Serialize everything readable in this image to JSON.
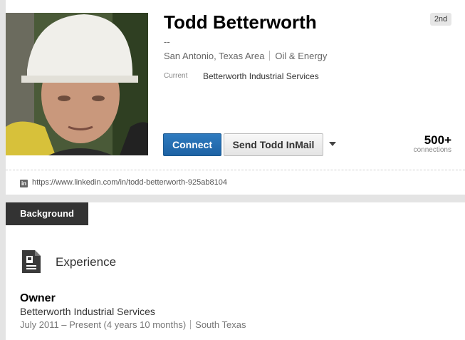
{
  "profile": {
    "name": "Todd Betterworth",
    "degree": "2nd",
    "headline": "--",
    "location": "San Antonio, Texas Area",
    "industry": "Oil & Energy",
    "current_label": "Current",
    "current_value": "Betterworth Industrial Services",
    "connect_label": "Connect",
    "inmail_label": "Send Todd InMail",
    "connections_count": "500+",
    "connections_label": "connections",
    "url": "https://www.linkedin.com/in/todd-betterworth-925ab8104"
  },
  "icons": {
    "linkedin": "linkedin-icon",
    "experience": "document-icon",
    "dropdown": "caret-down-icon"
  },
  "colors": {
    "connect_button": "#1d62a4",
    "background_tab": "#333333"
  },
  "background": {
    "tab_label": "Background",
    "experience_heading": "Experience",
    "positions": [
      {
        "title": "Owner",
        "company": "Betterworth Industrial Services",
        "dates": "July 2011 – Present (4 years 10 months)",
        "location": "South Texas"
      }
    ]
  }
}
